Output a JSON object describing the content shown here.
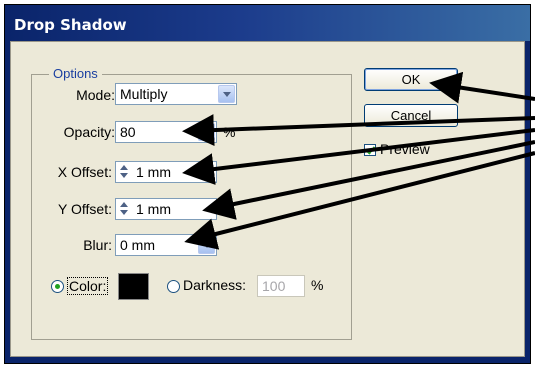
{
  "window": {
    "title": "Drop Shadow"
  },
  "options": {
    "legend": "Options",
    "mode": {
      "label": "Mode:",
      "value": "Multiply"
    },
    "opacity": {
      "label": "Opacity:",
      "value": "80",
      "unit": "%"
    },
    "x_offset": {
      "label": "X Offset:",
      "value": "1 mm"
    },
    "y_offset": {
      "label": "Y Offset:",
      "value": "1 mm"
    },
    "blur": {
      "label": "Blur:",
      "value": "0 mm"
    },
    "color": {
      "label": "Color:",
      "selected": true,
      "swatch": "#000000"
    },
    "darkness": {
      "label": "Darkness:",
      "value": "100",
      "unit": "%"
    }
  },
  "buttons": {
    "ok": "OK",
    "cancel": "Cancel"
  },
  "preview": {
    "label": "Preview",
    "checked": true
  },
  "colors": {
    "title_bar": "#0a246a",
    "dialog_bg": "#ece9d8",
    "arrows": "#000000"
  }
}
